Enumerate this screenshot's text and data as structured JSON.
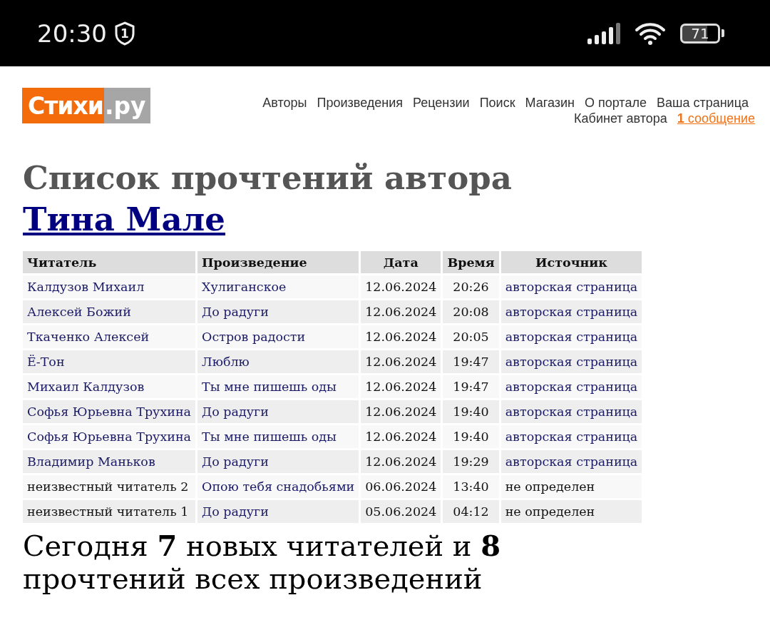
{
  "status_bar": {
    "time": "20:30",
    "shield_badge": "1",
    "battery": "71"
  },
  "header": {
    "logo_main": "Стихи",
    "logo_suffix": ".ру",
    "nav": [
      "Авторы",
      "Произведения",
      "Рецензии",
      "Поиск",
      "Магазин",
      "О портале",
      "Ваша страница"
    ],
    "cabinet": "Кабинет автора",
    "messages_count": "1",
    "messages_label": "сообщение"
  },
  "title": {
    "text": "Список прочтений автора",
    "author": "Тина Мале"
  },
  "table": {
    "columns": [
      "Читатель",
      "Произведение",
      "Дата",
      "Время",
      "Источник"
    ],
    "rows": [
      {
        "reader": "Калдузов Михаил",
        "reader_link": true,
        "work": "Хулиганское",
        "date": "12.06.2024",
        "time": "20:26",
        "source": "авторская страница",
        "source_link": true
      },
      {
        "reader": "Алексей Божий",
        "reader_link": true,
        "work": "До радуги",
        "date": "12.06.2024",
        "time": "20:08",
        "source": "авторская страница",
        "source_link": true
      },
      {
        "reader": "Ткаченко Алексей",
        "reader_link": true,
        "work": "Остров радости",
        "date": "12.06.2024",
        "time": "20:05",
        "source": "авторская страница",
        "source_link": true
      },
      {
        "reader": "Ё-Тон",
        "reader_link": true,
        "work": "Люблю",
        "date": "12.06.2024",
        "time": "19:47",
        "source": "авторская страница",
        "source_link": true
      },
      {
        "reader": "Михаил Калдузов",
        "reader_link": true,
        "work": "Ты мне пишешь оды",
        "date": "12.06.2024",
        "time": "19:47",
        "source": "авторская страница",
        "source_link": true
      },
      {
        "reader": "Софья Юрьевна Трухина",
        "reader_link": true,
        "work": "До радуги",
        "date": "12.06.2024",
        "time": "19:40",
        "source": "авторская страница",
        "source_link": true
      },
      {
        "reader": "Софья Юрьевна Трухина",
        "reader_link": true,
        "work": "Ты мне пишешь оды",
        "date": "12.06.2024",
        "time": "19:40",
        "source": "авторская страница",
        "source_link": true
      },
      {
        "reader": "Владимир Маньков",
        "reader_link": true,
        "work": "До радуги",
        "date": "12.06.2024",
        "time": "19:29",
        "source": "авторская страница",
        "source_link": true
      },
      {
        "reader": "неизвестный читатель 2",
        "reader_link": false,
        "work": "Опою тебя снадобьями",
        "date": "06.06.2024",
        "time": "13:40",
        "source": "не определен",
        "source_link": false
      },
      {
        "reader": "неизвестный читатель 1",
        "reader_link": false,
        "work": "До радуги",
        "date": "05.06.2024",
        "time": "04:12",
        "source": "не определен",
        "source_link": false
      }
    ]
  },
  "summary": "Сегодня **7** новых читателей и **8** прочтений всех произведений"
}
